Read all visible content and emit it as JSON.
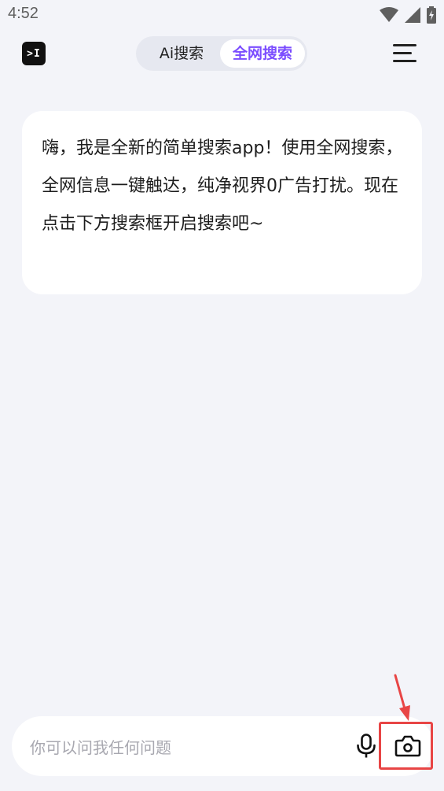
{
  "status_bar": {
    "time": "4:52"
  },
  "header": {
    "logo_text": ">I",
    "tabs": [
      {
        "label": "Ai搜索",
        "active": false
      },
      {
        "label": "全网搜索",
        "active": true
      }
    ]
  },
  "chat": {
    "message": "嗨，我是全新的简单搜索app！使用全网搜索，全网信息一键触达，纯净视界0广告打扰。现在点击下方搜索框开启搜索吧~"
  },
  "input": {
    "placeholder": "你可以问我任何问题"
  },
  "colors": {
    "accent": "#7b4dff",
    "highlight": "#e84545",
    "background": "#f3f4f9"
  },
  "icons": [
    "wifi-icon",
    "signal-icon",
    "battery-icon",
    "menu-icon",
    "microphone-icon",
    "camera-icon"
  ]
}
